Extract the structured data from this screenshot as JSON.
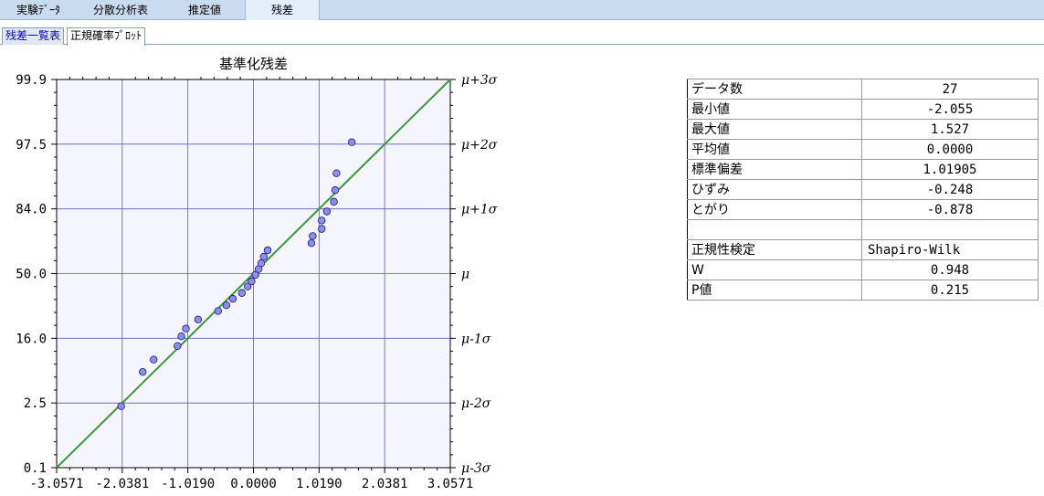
{
  "top_tabs": [
    {
      "label": "実験ﾃﾞｰﾀ"
    },
    {
      "label": "分散分析表"
    },
    {
      "label": "推定値"
    },
    {
      "label": "残差",
      "active": true
    }
  ],
  "sub_tabs": [
    {
      "label": "残差一覧表"
    },
    {
      "label": "正規確率ﾌﾟﾛｯﾄ",
      "active": true
    }
  ],
  "stats": {
    "rows": [
      {
        "label": "データ数",
        "value": "27"
      },
      {
        "label": "最小値",
        "value": "-2.055"
      },
      {
        "label": "最大値",
        "value": "1.527"
      },
      {
        "label": "平均値",
        "value": "0.0000"
      },
      {
        "label": "標準偏差",
        "value": "1.01905"
      },
      {
        "label": "ひずみ",
        "value": "-0.248"
      },
      {
        "label": "とがり",
        "value": "-0.878"
      },
      {
        "label": "",
        "value": ""
      },
      {
        "label": "正規性検定",
        "value": "Shapiro-Wilk"
      },
      {
        "label": "W",
        "value": "0.948"
      },
      {
        "label": "P値",
        "value": "0.215"
      }
    ]
  },
  "chart_data": {
    "type": "scatter",
    "title": "基準化残差",
    "x_tick_labels": [
      "-3.0571",
      "-2.0381",
      "-1.0190",
      "0.0000",
      "1.0190",
      "2.0381",
      "3.0571"
    ],
    "x_ticks": [
      -3.0571,
      -2.0381,
      -1.019,
      0.0,
      1.019,
      2.0381,
      3.0571
    ],
    "xlim": [
      -3.0571,
      3.0571
    ],
    "y_left_tick_labels": [
      "0.1",
      "2.5",
      "16.0",
      "50.0",
      "84.0",
      "97.5",
      "99.9"
    ],
    "y_right_tick_labels": [
      "μ-3σ",
      "μ-2σ",
      "μ-1σ",
      "μ",
      "μ+1σ",
      "μ+2σ",
      "μ+3σ"
    ],
    "y_ticks_z": [
      -3,
      -2,
      -1,
      0,
      1,
      2,
      3
    ],
    "ylim_z": [
      -3,
      3
    ],
    "grid": true,
    "reference_line": {
      "from": [
        -3.0571,
        -3
      ],
      "to": [
        3.0571,
        3
      ],
      "color": "#3a9a3a"
    },
    "marker_color": "#8c8cf2",
    "plot_background": "#f5f5ff",
    "points": [
      {
        "x": -2.055,
        "z": -2.05
      },
      {
        "x": -1.72,
        "z": -1.52
      },
      {
        "x": -1.55,
        "z": -1.33
      },
      {
        "x": -1.18,
        "z": -1.12
      },
      {
        "x": -1.12,
        "z": -0.97
      },
      {
        "x": -1.05,
        "z": -0.85
      },
      {
        "x": -0.86,
        "z": -0.71
      },
      {
        "x": -0.55,
        "z": -0.58
      },
      {
        "x": -0.42,
        "z": -0.49
      },
      {
        "x": -0.32,
        "z": -0.39
      },
      {
        "x": -0.18,
        "z": -0.3
      },
      {
        "x": -0.09,
        "z": -0.2
      },
      {
        "x": -0.03,
        "z": -0.12
      },
      {
        "x": 0.03,
        "z": -0.02
      },
      {
        "x": 0.08,
        "z": 0.07
      },
      {
        "x": 0.12,
        "z": 0.16
      },
      {
        "x": 0.16,
        "z": 0.26
      },
      {
        "x": 0.22,
        "z": 0.36
      },
      {
        "x": 0.9,
        "z": 0.47
      },
      {
        "x": 0.92,
        "z": 0.58
      },
      {
        "x": 1.06,
        "z": 0.69
      },
      {
        "x": 1.06,
        "z": 0.82
      },
      {
        "x": 1.14,
        "z": 0.96
      },
      {
        "x": 1.25,
        "z": 1.11
      },
      {
        "x": 1.27,
        "z": 1.29
      },
      {
        "x": 1.29,
        "z": 1.55
      },
      {
        "x": 1.527,
        "z": 2.03
      }
    ]
  }
}
